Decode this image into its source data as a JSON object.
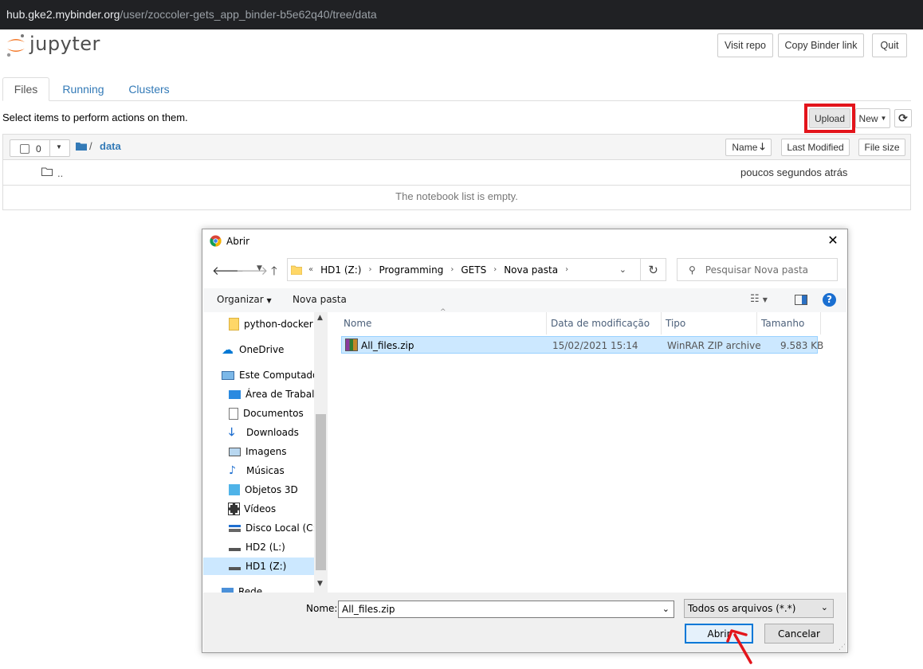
{
  "browser": {
    "url_host": "hub.gke2.mybinder.org",
    "url_path": "/user/zoccoler-gets_app_binder-b5e62q40/tree/data"
  },
  "header": {
    "logo_text": "jupyter",
    "visit_repo": "Visit repo",
    "copy_binder_link": "Copy Binder link",
    "quit": "Quit"
  },
  "tabs": [
    {
      "label": "Files"
    },
    {
      "label": "Running"
    },
    {
      "label": "Clusters"
    }
  ],
  "toolbar": {
    "hint": "Select items to perform actions on them.",
    "upload": "Upload",
    "new": "New"
  },
  "list": {
    "selected_count": "0",
    "path_sep": "/",
    "path_folder": "data",
    "sort_name": "Name",
    "sort_modified": "Last Modified",
    "sort_size": "File size",
    "parent_dir": "..",
    "parent_modified": "poucos segundos atrás",
    "empty_message": "The notebook list is empty."
  },
  "dialog": {
    "title": "Abrir",
    "breadcrumb": [
      "HD1 (Z:)",
      "Programming",
      "GETS",
      "Nova pasta"
    ],
    "breadcrumb_prefix": "«",
    "search_placeholder": "Pesquisar Nova pasta",
    "organize": "Organizar",
    "new_folder": "Nova pasta",
    "nav_items": [
      {
        "label": "python-docker"
      },
      {
        "label": "OneDrive"
      },
      {
        "label": "Este Computador"
      },
      {
        "label": "Área de Trabalho"
      },
      {
        "label": "Documentos"
      },
      {
        "label": "Downloads"
      },
      {
        "label": "Imagens"
      },
      {
        "label": "Músicas"
      },
      {
        "label": "Objetos 3D"
      },
      {
        "label": "Vídeos"
      },
      {
        "label": "Disco Local (C:)"
      },
      {
        "label": "HD2 (L:)"
      },
      {
        "label": "HD1 (Z:)"
      },
      {
        "label": "Rede"
      }
    ],
    "columns": {
      "name": "Nome",
      "modified": "Data de modificação",
      "type": "Tipo",
      "size": "Tamanho"
    },
    "file": {
      "name": "All_files.zip",
      "modified": "15/02/2021 15:14",
      "type": "WinRAR ZIP archive",
      "size": "9.583 KB"
    },
    "filename_label": "Nome:",
    "filename_value": "All_files.zip",
    "filetype": "Todos os arquivos (*.*)",
    "open_button": "Abrir",
    "cancel_button": "Cancelar"
  },
  "colors": {
    "highlight": "#e3141b",
    "link": "#337ab7",
    "selection": "#cce8ff",
    "jupyter_orange": "#f37726"
  }
}
